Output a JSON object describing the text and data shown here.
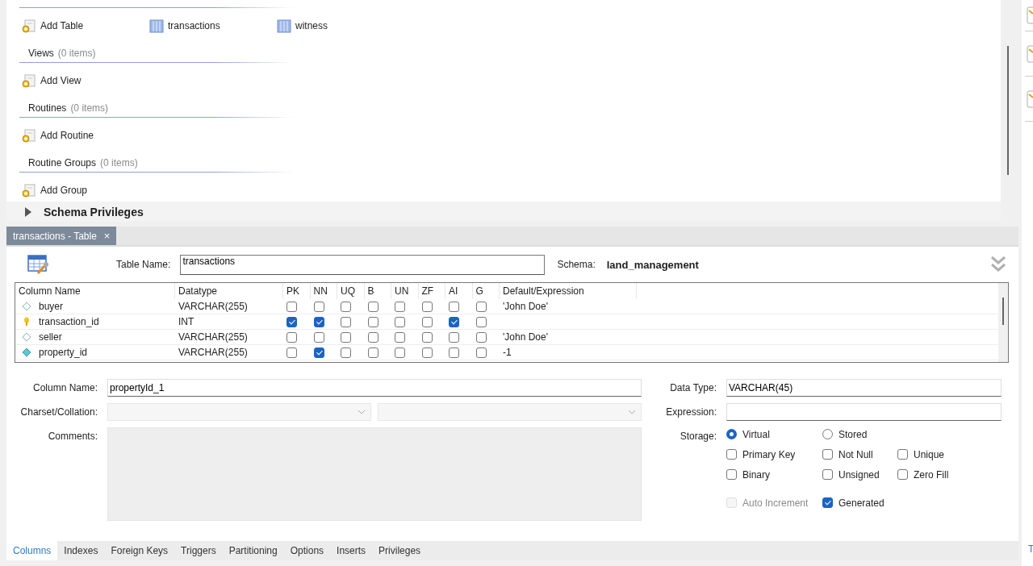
{
  "schema_overview": {
    "sections": [
      {
        "items": [
          {
            "label": "Add Table",
            "kind": "add"
          },
          {
            "label": "transactions",
            "kind": "table"
          },
          {
            "label": "witness",
            "kind": "table"
          }
        ]
      },
      {
        "title": "Views",
        "count": "(0 items)",
        "items": [
          {
            "label": "Add View",
            "kind": "add"
          }
        ]
      },
      {
        "title": "Routines",
        "count": "(0 items)",
        "items": [
          {
            "label": "Add Routine",
            "kind": "add"
          }
        ]
      },
      {
        "title": "Routine Groups",
        "count": "(0 items)",
        "items": [
          {
            "label": "Add Group",
            "kind": "add"
          }
        ]
      }
    ]
  },
  "schema_privileges": {
    "label": "Schema Privileges",
    "expanded": false
  },
  "document_tab": {
    "label": "transactions - Table",
    "close": "×"
  },
  "table_editor": {
    "table_name_label": "Table Name:",
    "table_name": "transactions",
    "schema_label": "Schema:",
    "schema": "land_management",
    "grid": {
      "columns": [
        "Column Name",
        "Datatype",
        "PK",
        "NN",
        "UQ",
        "B",
        "UN",
        "ZF",
        "AI",
        "G",
        "Default/Expression"
      ],
      "rows": [
        {
          "kind": "nullable",
          "name": "buyer",
          "datatype": "VARCHAR(255)",
          "flags": [
            false,
            false,
            false,
            false,
            false,
            false,
            false,
            false
          ],
          "default": "'John Doe'"
        },
        {
          "kind": "primary",
          "name": "transaction_id",
          "datatype": "INT",
          "flags": [
            true,
            true,
            false,
            false,
            false,
            false,
            true,
            false
          ]
        },
        {
          "kind": "nullable",
          "name": "seller",
          "datatype": "VARCHAR(255)",
          "flags": [
            false,
            false,
            false,
            false,
            false,
            false,
            false,
            false
          ],
          "default": "'John Doe'"
        },
        {
          "kind": "not_null",
          "name": "property_id",
          "datatype": "VARCHAR(255)",
          "flags": [
            false,
            true,
            false,
            false,
            false,
            false,
            false,
            false
          ],
          "default": "-1"
        }
      ]
    }
  },
  "column_details": {
    "column_name_label": "Column Name:",
    "column_name": "propertyId_1",
    "charset_label": "Charset/Collation:",
    "comments_label": "Comments:",
    "data_type_label": "Data Type:",
    "data_type": "VARCHAR(45)",
    "expression_label": "Expression:",
    "storage_label": "Storage:",
    "storage": [
      {
        "label": "Virtual",
        "selected": true
      },
      {
        "label": "Stored",
        "selected": false
      }
    ],
    "options": [
      {
        "label": "Primary Key",
        "checked": false,
        "disabled": false
      },
      {
        "label": "Not Null",
        "checked": false,
        "disabled": false
      },
      {
        "label": "Unique",
        "checked": false,
        "disabled": false
      },
      {
        "label": "Binary",
        "checked": false,
        "disabled": false
      },
      {
        "label": "Unsigned",
        "checked": false,
        "disabled": false
      },
      {
        "label": "Zero Fill",
        "checked": false,
        "disabled": false
      },
      {
        "label": "Auto Increment",
        "checked": false,
        "disabled": true
      },
      {
        "label": "Generated",
        "checked": true,
        "disabled": false
      }
    ]
  },
  "bottom_tabs": [
    {
      "label": "Columns",
      "selected": true
    },
    {
      "label": "Indexes",
      "selected": false
    },
    {
      "label": "Foreign Keys",
      "selected": false
    },
    {
      "label": "Triggers",
      "selected": false
    },
    {
      "label": "Partitioning",
      "selected": false
    },
    {
      "label": "Options",
      "selected": false
    },
    {
      "label": "Inserts",
      "selected": false
    },
    {
      "label": "Privileges",
      "selected": false
    }
  ],
  "side_panel": {
    "tab": "T"
  }
}
